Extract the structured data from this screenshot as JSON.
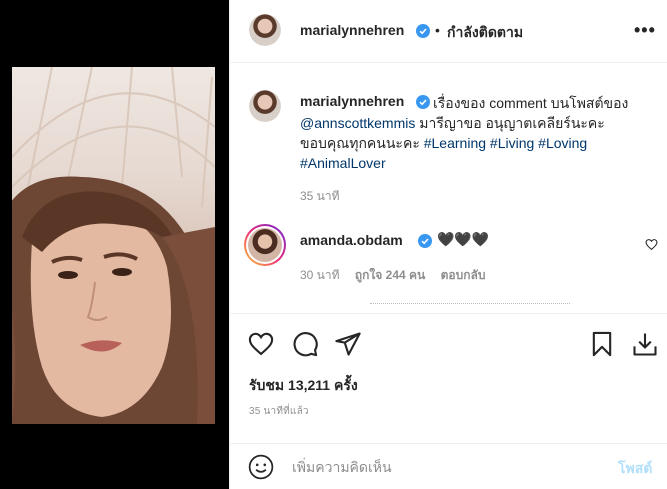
{
  "post_header": {
    "username": "marialynnehren",
    "separator": "•",
    "follow_label": "กำลังติดตาม",
    "more_label": "•••"
  },
  "caption": {
    "username": "marialynnehren",
    "text_part1": "เรื่องของ comment บนโพสต์ของ",
    "mention": "@annscottkemmis",
    "text_part2": "มารีญาขอ อนุญาตเคลียร์นะคะ ขอบคุณทุกคนนะคะ",
    "hashtags": [
      "#Learning",
      "#Living",
      "#Loving",
      "#AnimalLover"
    ],
    "time": "35 นาที"
  },
  "comment": {
    "username": "amanda.obdam",
    "text": "🖤🖤🖤",
    "time": "30 นาที",
    "likes": "ถูกใจ 244 คน",
    "reply_label": "ตอบกลับ"
  },
  "stats": {
    "views": "รับชม 13,211 ครั้ง",
    "posted": "35 นาทีที่แล้ว"
  },
  "add_comment": {
    "placeholder": "เพิ่มความคิดเห็น",
    "post_label": "โพสต์"
  },
  "colors": {
    "verified": "#3897f0",
    "link": "#00376b",
    "muted": "#8e8e8e",
    "post_disabled": "#b2dffc"
  }
}
